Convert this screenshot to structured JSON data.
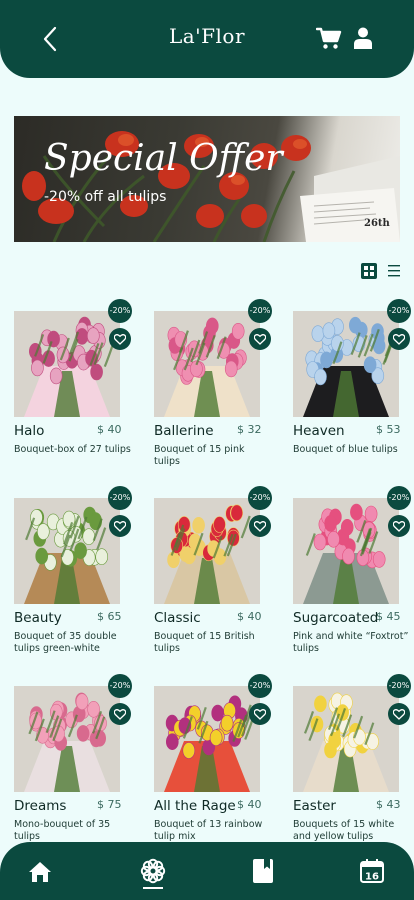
{
  "header": {
    "brand": "La'Flor",
    "back_icon": "chevron-left-icon",
    "cart_icon": "cart-icon",
    "user_icon": "user-icon",
    "background": "#0b4a3f"
  },
  "banner": {
    "title": "Special Offer",
    "subtitle": "-20% off all tulips"
  },
  "view_toggle": {
    "active": "grid",
    "options": [
      "grid-icon",
      "list-icon"
    ]
  },
  "products": [
    {
      "name": "Halo",
      "price": "$ 40",
      "description": "Bouquet-box of 27 tulips",
      "badge": "-20%",
      "colors": [
        "#e7a3c0",
        "#c04c7e",
        "#f4d3df"
      ]
    },
    {
      "name": "Ballerine",
      "price": "$ 32",
      "description": "Bouquet of 15 pink tulips",
      "badge": "-20%",
      "colors": [
        "#ef8fb1",
        "#d95888",
        "#efe1c9"
      ]
    },
    {
      "name": "Heaven",
      "price": "$ 53",
      "description": "Bouquet of blue tulips",
      "badge": "-20%",
      "colors": [
        "#b9d3ec",
        "#7ea9d6",
        "#1d1d1f"
      ]
    },
    {
      "name": "Beauty",
      "price": "$ 65",
      "description": "Bouquet of 35 double tulips green-white",
      "badge": "-20%",
      "colors": [
        "#e9f0dc",
        "#6a9a3e",
        "#b58a57"
      ]
    },
    {
      "name": "Classic",
      "price": "$ 40",
      "description": "Bouquet of 15 British tulips",
      "badge": "-20%",
      "colors": [
        "#d9293b",
        "#f0d06a",
        "#d9c7a4"
      ]
    },
    {
      "name": "Sugarcoated",
      "price": "$ 45",
      "description": "Pink and white “Foxtrot” tulips",
      "badge": "-20%",
      "colors": [
        "#f08ab0",
        "#e5507f",
        "#8c9a92"
      ]
    },
    {
      "name": "Dreams",
      "price": "$ 75",
      "description": "Mono-bouquet of 35 tulips",
      "badge": "-20%",
      "colors": [
        "#f2a0b9",
        "#d86a8e",
        "#e9dfe0"
      ]
    },
    {
      "name": "All the Rage",
      "price": "$ 40",
      "description": "Bouquet of 13 rainbow tulip mix",
      "badge": "-20%",
      "colors": [
        "#f3d02a",
        "#b2307e",
        "#e7503b"
      ]
    },
    {
      "name": "Easter",
      "price": "$ 43",
      "description": "Bouquets of 15 white and yellow tulips",
      "badge": "-20%",
      "colors": [
        "#f6f3e4",
        "#f1d23f",
        "#e7dccb"
      ]
    }
  ],
  "tabbar": {
    "items": [
      "home-icon",
      "flower-icon",
      "book-icon",
      "calendar-icon"
    ],
    "active": "flower-icon",
    "calendar_day": "16"
  }
}
